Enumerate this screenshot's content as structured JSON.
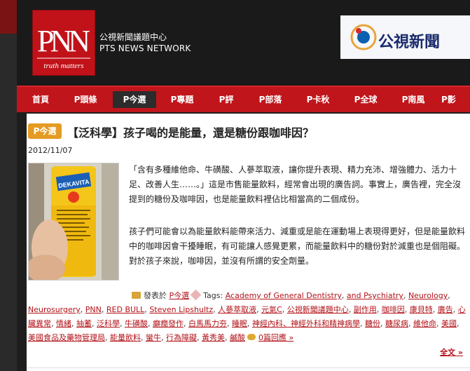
{
  "site": {
    "logo_letters": "PNN",
    "logo_tagline": "truth matters",
    "name_zh": "公視新聞議題中心",
    "name_en": "PTS NEWS NETWORK",
    "banner_text": "公視新聞"
  },
  "nav": {
    "items": [
      {
        "label": "首頁",
        "active": false
      },
      {
        "label": "P頭條",
        "active": false
      },
      {
        "label": "P今選",
        "active": true
      },
      {
        "label": "P專題",
        "active": false
      },
      {
        "label": "P評",
        "active": false
      },
      {
        "label": "P部落",
        "active": false
      },
      {
        "label": "P卡秋",
        "active": false
      },
      {
        "label": "P全球",
        "active": false
      },
      {
        "label": "P南風",
        "active": false
      },
      {
        "label": "P影",
        "active": false
      }
    ]
  },
  "post": {
    "badge": "P今選",
    "title": "【泛科學】孩子喝的是能量，還是糖份跟咖啡因？",
    "date": "2012/11/07",
    "photo_brand": "DEKAVITA",
    "paragraph1": "「含有多種維他命、牛磺酸、人蔘萃取液，讓你提升表現、精力充沛、增強體力、活力十足、改善人生……。」這是市售能量飲料，經常會出現的廣告詞。事實上，廣告裡，完全沒提到的糖份及咖啡因，也是能量飲料裡佔比相當高的二個成份。",
    "paragraph2": "孩子們可能會以為能量飲料能帶來活力、減重或是能在運動場上表現得更好，但是能量飲料中的咖啡因會干擾睡眠，有可能讓人感覺更累，而能量飲料中的糖份對於減重也是個阻礙。對於孩子來說，咖啡因，並沒有所謂的安全劑量。",
    "posted_in_label": "發表於",
    "category": "P今選",
    "tags_label": "Tags:",
    "tags": [
      "Academy of General Dentistry",
      "and Psychiatry",
      "Neurology",
      "Neurosurgery",
      "PNN",
      "RED BULL",
      "Steven Lipshultz",
      "人蔘萃取液",
      "元氣C",
      "公視新聞議題中心",
      "副作用",
      "咖啡因",
      "康貝特",
      "廣告",
      "心臟異常",
      "情緒",
      "抽蓄",
      "泛科學",
      "牛磺酸",
      "癲癇發作",
      "白馬馬力夯",
      "睡眠",
      "神經內科、神經外科和精神病學",
      "糖份",
      "糖尿病",
      "維他命",
      "美國",
      "美國食品及藥物管理局",
      "能量飲料",
      "蠻牛",
      "行為障礙",
      "黃秀美",
      "鹹酸"
    ],
    "comments": "0篇回應 »",
    "read_more": "全文 »"
  },
  "colors": {
    "brand_red": "#c0151b",
    "badge_orange": "#e59b22",
    "link_red": "#b21218"
  }
}
